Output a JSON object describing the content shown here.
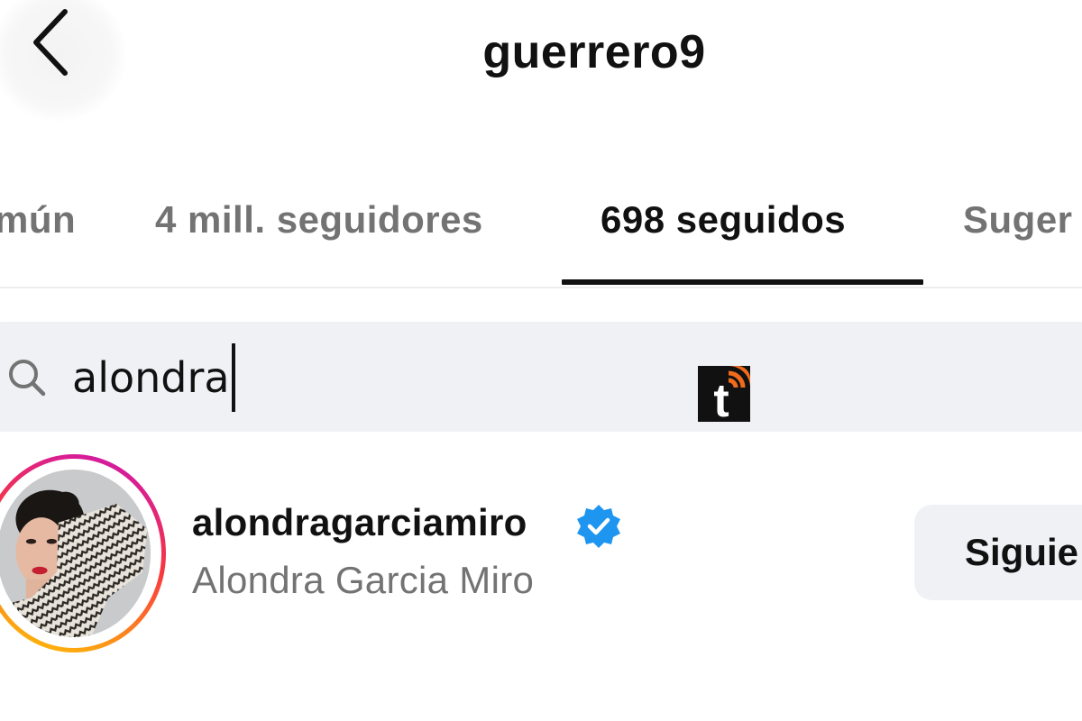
{
  "header": {
    "title": "guerrero9",
    "back_icon": "chevron-left-icon"
  },
  "tabs": [
    {
      "label": "mún",
      "active": false
    },
    {
      "label": "4 mill. seguidores",
      "active": false
    },
    {
      "label": "698 seguidos",
      "active": true
    },
    {
      "label": "Suger",
      "active": false
    }
  ],
  "search": {
    "value": "alondra",
    "icon": "search-icon"
  },
  "watermark": {
    "text": "t",
    "colors": {
      "background": "#111111",
      "accent": "#f26a1b"
    }
  },
  "results": [
    {
      "username": "alondragarciamiro",
      "full_name": "Alondra Garcia Miro",
      "verified": true,
      "follow_label": "Siguie"
    }
  ],
  "colors": {
    "text_primary": "#111111",
    "text_secondary": "#737373",
    "search_bg": "#eff1f4",
    "verified_blue": "#1e96f0",
    "story_ring": [
      "#c913b9",
      "#f9373f",
      "#fecd00"
    ]
  }
}
